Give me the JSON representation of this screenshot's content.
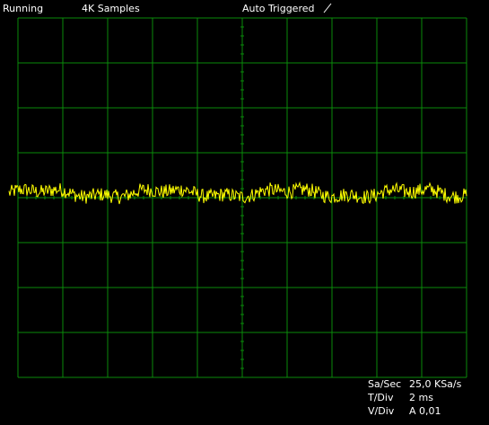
{
  "status_bar": {
    "run_state": "Running",
    "samples": "4K Samples",
    "trigger_mode": "Auto Triggered",
    "trigger_slope_icon": "rising-edge-icon"
  },
  "readouts": {
    "sa_sec_label": "Sa/Sec",
    "sa_sec_value": "25,0 KSa/s",
    "t_div_label": "T/Div",
    "t_div_value": "2 ms",
    "v_div_label": "V/Div",
    "v_div_value": "A 0,01"
  },
  "colors": {
    "background": "#000000",
    "grid": "#0a8a0a",
    "trace": "#ffff00",
    "text": "#ffffff"
  },
  "display": {
    "h_divisions": 10,
    "v_divisions": 8
  },
  "chart_data": {
    "type": "line",
    "x_range_div": [
      0,
      10
    ],
    "y_range_div": [
      -4,
      4
    ],
    "trace_mean_div": 0.1,
    "noise_amplitude_div": 0.2
  }
}
